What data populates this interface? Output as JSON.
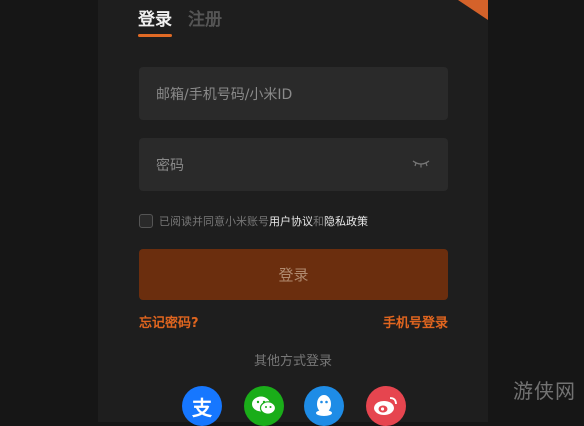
{
  "tabs": {
    "login": "登录",
    "register": "注册"
  },
  "fields": {
    "account_placeholder": "邮箱/手机号码/小米ID",
    "password_placeholder": "密码"
  },
  "agreement": {
    "prefix": "已阅读并同意小米账号",
    "user_agreement": "用户协议",
    "and": "和",
    "privacy_policy": "隐私政策"
  },
  "login_button": "登录",
  "forgot_password": "忘记密码?",
  "phone_login": "手机号登录",
  "other_methods": "其他方式登录",
  "social": [
    {
      "name": "alipay",
      "color": "#1677ff",
      "glyph": "支"
    },
    {
      "name": "wechat",
      "color": "#1aad19"
    },
    {
      "name": "qq",
      "color": "#1e8ce6"
    },
    {
      "name": "weibo",
      "color": "#e6454f"
    }
  ],
  "watermark": "游侠网",
  "colors": {
    "accent": "#e0651f",
    "panel": "#1e1e1e",
    "button": "#6b2e0e"
  }
}
